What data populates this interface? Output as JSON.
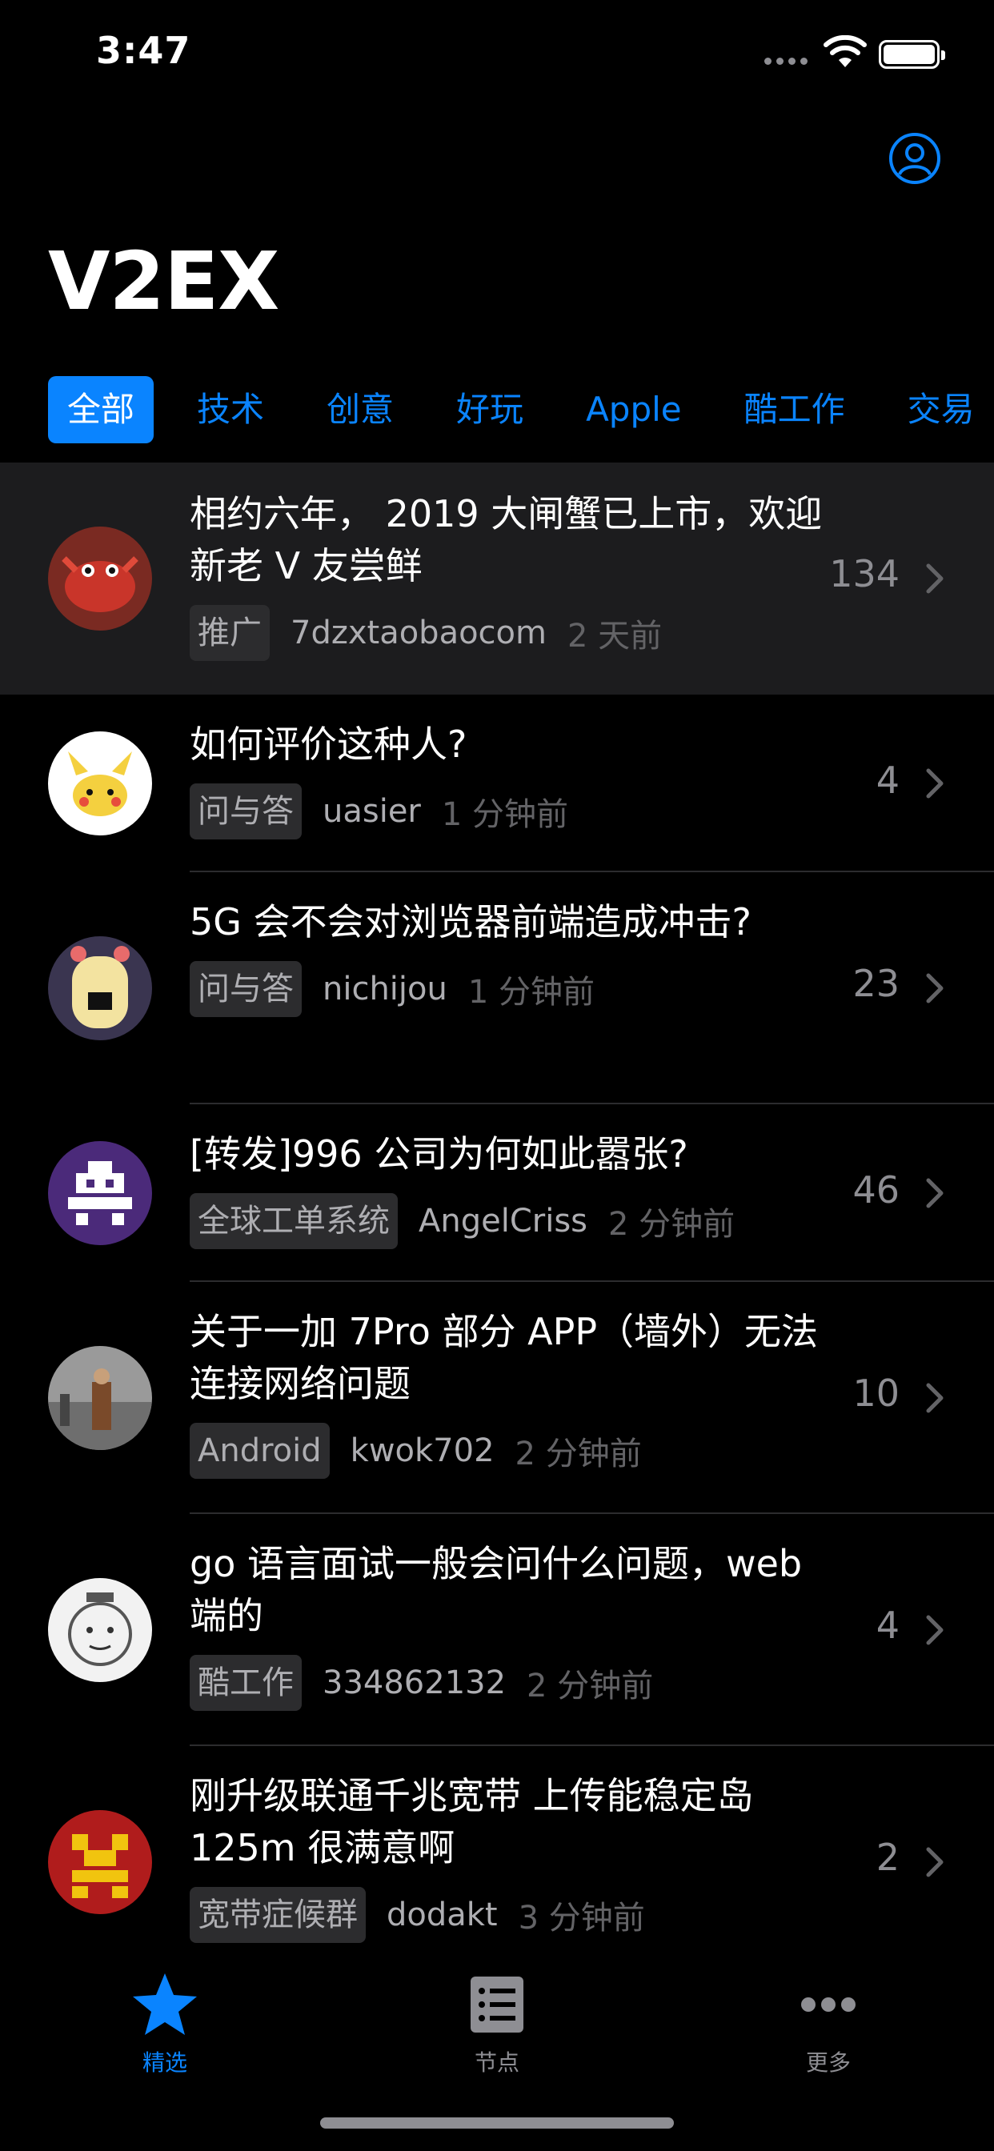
{
  "status_bar": {
    "time": "3:47"
  },
  "header": {
    "title": "V2EX"
  },
  "tabs": [
    {
      "label": "全部",
      "active": true
    },
    {
      "label": "技术",
      "active": false
    },
    {
      "label": "创意",
      "active": false
    },
    {
      "label": "好玩",
      "active": false
    },
    {
      "label": "Apple",
      "active": false
    },
    {
      "label": "酷工作",
      "active": false
    },
    {
      "label": "交易",
      "active": false
    }
  ],
  "topics": [
    {
      "title": "相约六年， 2019 大闸蟹已上市，欢迎新老 V 友尝鲜",
      "node": "推广",
      "author": "7dzxtaobaocom",
      "time_ago": "2 天前",
      "replies": "134"
    },
    {
      "title": "如何评价这种人?",
      "node": "问与答",
      "author": "uasier",
      "time_ago": "1 分钟前",
      "replies": "4"
    },
    {
      "title": "5G 会不会对浏览器前端造成冲击?",
      "node": "问与答",
      "author": "nichijou",
      "time_ago": "1 分钟前",
      "replies": "23"
    },
    {
      "title": "[转发]996 公司为何如此嚣张?",
      "node": "全球工单系统",
      "author": "AngelCriss",
      "time_ago": "2 分钟前",
      "replies": "46"
    },
    {
      "title": "关于一加 7Pro 部分 APP（墙外）无法连接网络问题",
      "node": "Android",
      "author": "kwok702",
      "time_ago": "2 分钟前",
      "replies": "10"
    },
    {
      "title": "go 语言面试一般会问什么问题，web 端的",
      "node": "酷工作",
      "author": "334862132",
      "time_ago": "2 分钟前",
      "replies": "4"
    },
    {
      "title": "刚升级联通千兆宽带 上传能稳定岛 125m 很满意啊",
      "node": "宽带症候群",
      "author": "dodakt",
      "time_ago": "3 分钟前",
      "replies": "2"
    }
  ],
  "tabbar": {
    "featured_label": "精选",
    "nodes_label": "节点",
    "more_label": "更多"
  },
  "colors": {
    "accent": "#0a84ff",
    "background": "#000000",
    "highlight_row": "#1c1c1e"
  }
}
